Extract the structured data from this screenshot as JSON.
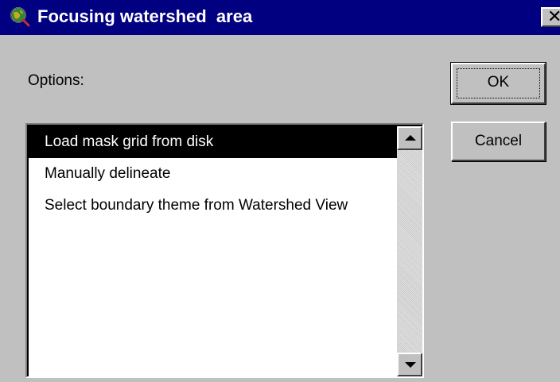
{
  "window": {
    "title": "Focusing watershed  area",
    "title_bar_color": "#000080",
    "icon": "globe-magnifier-icon",
    "close_symbol": "✕"
  },
  "options": {
    "label": "Options:",
    "items": [
      {
        "label": "Load mask grid from disk",
        "selected": true
      },
      {
        "label": "Manually delineate",
        "selected": false
      },
      {
        "label": "Select boundary theme from Watershed View",
        "selected": false
      }
    ]
  },
  "buttons": {
    "ok_label": "OK",
    "cancel_label": "Cancel"
  }
}
